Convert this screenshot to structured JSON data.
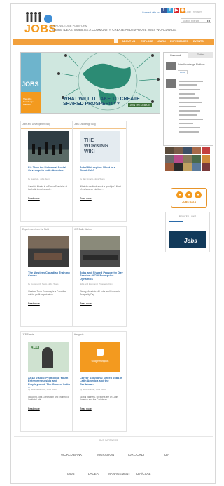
{
  "header": {
    "logo_text": "JOBS",
    "logo_sub": "A KNOWLEDGE PLATFORM",
    "tagline": "SHARE IDEAS. MOBILIZE A COMMUNITY. CREATE AND IMPROVE JOBS WORLDWIDE.",
    "social_label": "Connect with us",
    "social": [
      {
        "icon": "facebook-icon",
        "letter": "f",
        "color": "#3b5998"
      },
      {
        "icon": "twitter-icon",
        "letter": "t",
        "color": "#34a0d8"
      },
      {
        "icon": "youtube-icon",
        "letter": "▶",
        "color": "#d8262d"
      },
      {
        "icon": "rss-icon",
        "letter": "◉",
        "color": "#f38b1c"
      }
    ],
    "top_links": "Login  |  Register",
    "search_placeholder": "Search this site"
  },
  "nav": {
    "items": [
      "ABOUT US",
      "EXPLORE",
      "LEARN",
      "EXPERIENCES",
      "EVENTS"
    ]
  },
  "hero": {
    "side_label": "JOBS",
    "side_text": "The Jobs Knowledge Platform",
    "title": "WHAT WILL IT TAKE TO CREATE SHARED PROSPERITY?",
    "button": "JOIN THE DEBATE"
  },
  "sidebar": {
    "tabs": [
      "Facebook",
      "Twitter"
    ],
    "twitter_name": "Jobs Knowledge Platform",
    "follow_label": "Follow",
    "jobs_widget_label": "JOBS DATA",
    "related_title": "RELATED LINKS",
    "related_caption": "Jobs",
    "colors": {
      "orange": "#f39a1f",
      "navy": "#123a5a"
    }
  },
  "cards": [
    {
      "tag": "Jobs and Development Blog",
      "title": "It's Time for Universal Social Coverage in Latin America",
      "meta": "by Gabriela, Jobs Team",
      "excerpt": "Gabriela Morán is a Senior Specialist at the Latin America and...",
      "more": "Read more",
      "image": "crowd"
    },
    {
      "tag": "Jobs Knowledge Blog",
      "title": "JobsWiki.org/en: What is a Good Job?",
      "meta": "by Jan Ignacio, Jobs Team",
      "excerpt": "What do we think about a good job? Most of us have an intuition...",
      "more": "Read more",
      "image": "wiki"
    },
    {
      "tag": "Experiences from the Field",
      "title": "The Western Canadian Training Centre",
      "meta": "by Community Team, Jobs Team",
      "excerpt": "Western Tools Economy is a Canadian not-for-profit organization...",
      "more": "Read more",
      "image": "classroom"
    },
    {
      "tag": "JKP Daily Stories",
      "title": "Jobs and Shared Prosperity Day Session: ACDI Enterprise Dynamics",
      "meta": "Jobs and Economic Prosperity Day",
      "excerpt": "Strong Mountain Hill Jobs and Economic Prosperity Day...",
      "more": "Read more",
      "image": "meeting"
    },
    {
      "tag": "JKP Events",
      "title": "ACDI Vision: Promoting Youth Entrepreneurship and Employment: The Case of Latin ...",
      "meta": "by Jessica Benson, Jobs Team",
      "excerpt": "Including Jobs Generation and Training of Youth in Latin...",
      "more": "Read more",
      "image": "youth"
    },
    {
      "tag": "Hangouts",
      "title": "Career Solutions: Green Jobs in Latin America and the Caribbean",
      "meta": "by Jordi Manuel, Jobs Team",
      "excerpt": "Global partners, speakers are on Latin America and the Caribbean...",
      "more": "Read more",
      "image": "hangout"
    }
  ],
  "partners_title": "OUR PARTNERS",
  "partners": [
    "WORLD BANK",
    "MIGRATION",
    "IDRC  CRDI",
    "IZA",
    "IADB",
    "LACEA",
    "MANAGEMENT",
    "IZA/CSAE"
  ]
}
